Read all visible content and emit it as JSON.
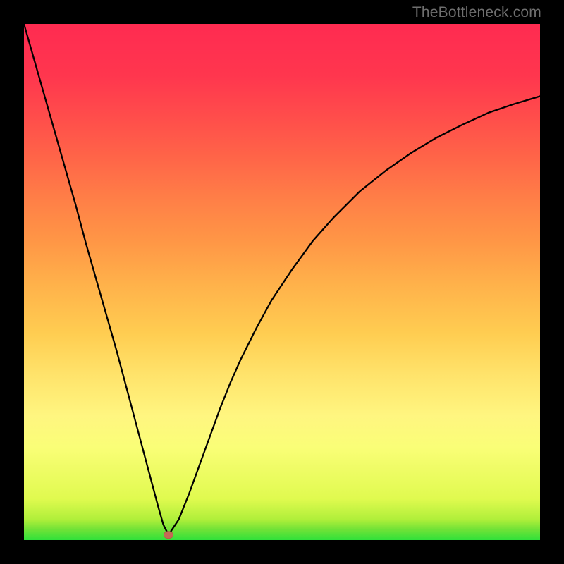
{
  "watermark": {
    "text": "TheBottleneck.com"
  },
  "colors": {
    "frame": "#000000",
    "curve_stroke": "#000000",
    "marker_fill": "#c46a55",
    "marker_stroke": "#b35a45"
  },
  "chart_data": {
    "type": "line",
    "title": "",
    "xlabel": "",
    "ylabel": "",
    "xlim": [
      0,
      100
    ],
    "ylim": [
      0,
      100
    ],
    "grid": false,
    "legend": false,
    "comment": "Values estimated from pixels; curve represents a V-shaped bottleneck profile with minimum near x≈28. Y expressed as percent of plot height (0=bottom, 100=top).",
    "series": [
      {
        "name": "curve",
        "x": [
          0,
          2,
          4,
          6,
          8,
          10,
          12,
          14,
          16,
          18,
          20,
          22,
          24,
          26,
          27,
          28,
          30,
          32,
          34,
          36,
          38,
          40,
          42,
          45,
          48,
          52,
          56,
          60,
          65,
          70,
          75,
          80,
          85,
          90,
          95,
          100
        ],
        "y": [
          100,
          93,
          86,
          79,
          72,
          65,
          57.5,
          50.5,
          43.5,
          36.5,
          29,
          21.5,
          14,
          6.5,
          3,
          1,
          4,
          9,
          14.5,
          20,
          25.5,
          30.5,
          35,
          41,
          46.5,
          52.5,
          58,
          62.5,
          67.5,
          71.5,
          75,
          78,
          80.5,
          82.8,
          84.5,
          86
        ]
      }
    ],
    "marker": {
      "x": 28,
      "y": 1,
      "rx": 0.9,
      "ry": 0.7
    }
  }
}
